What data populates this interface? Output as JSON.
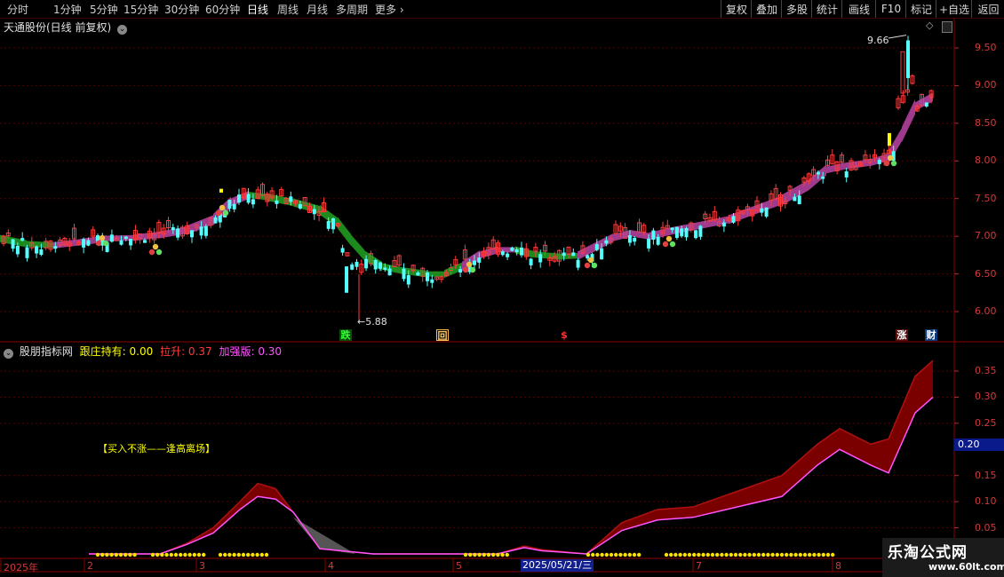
{
  "toolbar": {
    "periods": [
      "分时",
      "1分钟",
      "5分钟",
      "15分钟",
      "30分钟",
      "60分钟",
      "日线",
      "周线",
      "月线",
      "多周期",
      "更多"
    ],
    "active": "日线",
    "right_buttons": [
      "复权",
      "叠加",
      "多股",
      "统计",
      "画线",
      "F10",
      "标记",
      "+自选",
      "返回"
    ]
  },
  "main_chart": {
    "title": "天通股份(日线 前复权)",
    "high_label": "9.66",
    "low_label": "5.88",
    "price_ticks": [
      "9.50",
      "9.00",
      "8.50",
      "8.00",
      "7.50",
      "7.00",
      "6.50",
      "6.00"
    ],
    "signals": [
      {
        "text": "跌",
        "color": "#22aa22"
      },
      {
        "text": "回",
        "color": "#ffcc66"
      },
      {
        "text": "$",
        "color": "#ff3333"
      },
      {
        "text": "涨",
        "color": "#ff3333"
      },
      {
        "text": "财",
        "color": "#3aa0ff"
      }
    ]
  },
  "indicator": {
    "name": "股朋指标网",
    "gen_label": "跟庄持有: 0.00",
    "la_label": "拉升: 0.37",
    "jq_label": "加强版: 0.30",
    "note": "【买入不涨——逢高离场】",
    "ticks": [
      "0.35",
      "0.30",
      "0.25",
      "0.15",
      "0.10",
      "0.05"
    ],
    "current_value": "0.20"
  },
  "x_axis": {
    "labels": [
      "2025年",
      "2",
      "3",
      "4",
      "5",
      "6",
      "7",
      "8"
    ],
    "cursor_date": "2025/05/21/三"
  },
  "watermark": {
    "name": "乐淘公式网",
    "url": "www.60lt.com"
  },
  "colors": {
    "up": "#ff3b3b",
    "down": "#54ffff",
    "band_up": "#a03a8c",
    "band_down": "#1c8a1c",
    "axis": "#8b0000"
  }
}
